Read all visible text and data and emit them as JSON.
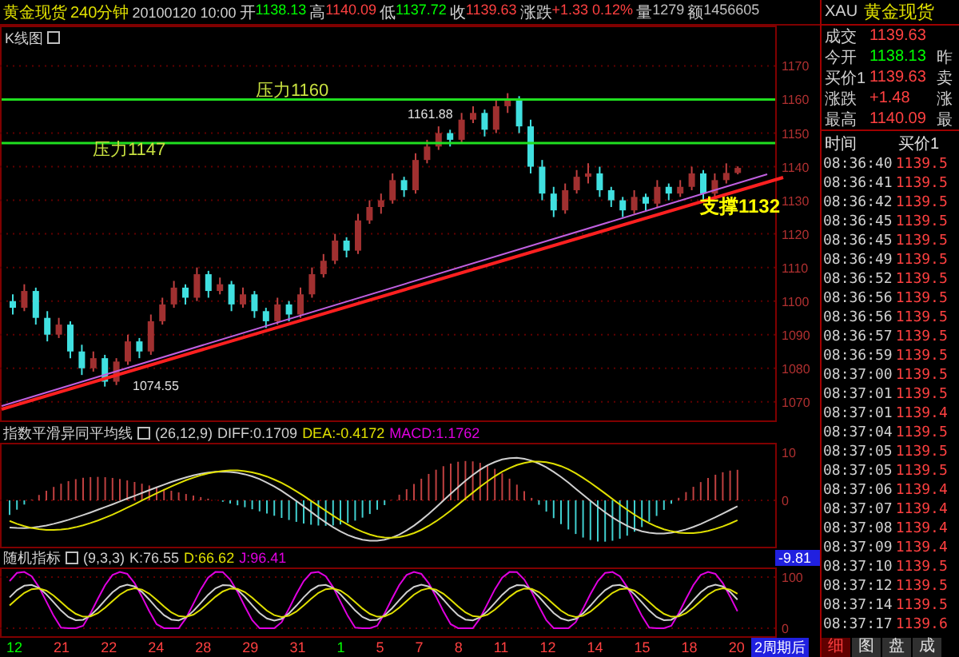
{
  "header": {
    "symbol": "黄金现货",
    "period": "240分钟",
    "datetime": "20100120 10:00",
    "fields": [
      {
        "label": "开",
        "value": "1138.13",
        "color": "#00ff00"
      },
      {
        "label": "高",
        "value": "1140.09",
        "color": "#ff4040"
      },
      {
        "label": "低",
        "value": "1137.72",
        "color": "#00ff00"
      },
      {
        "label": "收",
        "value": "1139.63",
        "color": "#ff4040"
      },
      {
        "label": "涨跌",
        "value": "+1.33 0.12%",
        "color": "#ff4040"
      },
      {
        "label": "量",
        "value": "1279",
        "color": "#c0c0c0"
      },
      {
        "label": "额",
        "value": "1456605",
        "color": "#c0c0c0"
      }
    ]
  },
  "main_chart": {
    "title": "K线图",
    "chart_data": {
      "type": "candlestick",
      "ylim": [
        1064,
        1182
      ],
      "yticks": [
        1170,
        1160,
        1150,
        1140,
        1130,
        1120,
        1110,
        1100,
        1090,
        1080,
        1070
      ],
      "grid": true,
      "ref_lines": [
        {
          "axis": "y",
          "value": 1160,
          "color": "#20e020"
        },
        {
          "axis": "y",
          "value": 1147,
          "color": "#20e020"
        }
      ],
      "ohlc": [
        [
          1100,
          1102,
          1096,
          1098
        ],
        [
          1098,
          1105,
          1097,
          1103
        ],
        [
          1103,
          1104,
          1093,
          1095
        ],
        [
          1095,
          1097,
          1088,
          1090
        ],
        [
          1090,
          1095,
          1089,
          1093
        ],
        [
          1093,
          1094,
          1083,
          1085
        ],
        [
          1085,
          1087,
          1078,
          1080
        ],
        [
          1080,
          1085,
          1079,
          1083
        ],
        [
          1083,
          1084,
          1074.55,
          1076
        ],
        [
          1076,
          1083,
          1075,
          1082
        ],
        [
          1082,
          1090,
          1081,
          1088
        ],
        [
          1088,
          1089,
          1083,
          1085
        ],
        [
          1085,
          1096,
          1084,
          1094
        ],
        [
          1094,
          1101,
          1093,
          1099
        ],
        [
          1099,
          1106,
          1098,
          1104
        ],
        [
          1104,
          1105,
          1099,
          1101
        ],
        [
          1101,
          1110,
          1100,
          1108
        ],
        [
          1108,
          1109,
          1101,
          1103
        ],
        [
          1103,
          1107,
          1102,
          1105
        ],
        [
          1105,
          1106,
          1097,
          1099
        ],
        [
          1099,
          1104,
          1098,
          1102
        ],
        [
          1102,
          1103,
          1095,
          1097
        ],
        [
          1097,
          1098,
          1092,
          1094
        ],
        [
          1094,
          1101,
          1093,
          1099
        ],
        [
          1099,
          1100,
          1094,
          1096
        ],
        [
          1096,
          1104,
          1095,
          1102
        ],
        [
          1102,
          1110,
          1101,
          1108
        ],
        [
          1108,
          1114,
          1107,
          1112
        ],
        [
          1112,
          1120,
          1111,
          1118
        ],
        [
          1118,
          1119,
          1113,
          1115
        ],
        [
          1115,
          1126,
          1114,
          1124
        ],
        [
          1124,
          1130,
          1123,
          1128
        ],
        [
          1128,
          1132,
          1126,
          1130
        ],
        [
          1130,
          1138,
          1129,
          1136
        ],
        [
          1136,
          1137,
          1131,
          1133
        ],
        [
          1133,
          1144,
          1132,
          1142
        ],
        [
          1142,
          1148,
          1141,
          1146
        ],
        [
          1146,
          1152,
          1145,
          1150
        ],
        [
          1150,
          1151,
          1146,
          1148
        ],
        [
          1148,
          1156,
          1147,
          1154
        ],
        [
          1154,
          1158,
          1153,
          1156
        ],
        [
          1156,
          1157,
          1149,
          1151
        ],
        [
          1151,
          1160,
          1150,
          1158
        ],
        [
          1158,
          1161.88,
          1156,
          1160
        ],
        [
          1160,
          1161,
          1150,
          1152
        ],
        [
          1152,
          1154,
          1138,
          1140
        ],
        [
          1140,
          1142,
          1130,
          1132
        ],
        [
          1132,
          1134,
          1125,
          1127
        ],
        [
          1127,
          1135,
          1126,
          1133
        ],
        [
          1133,
          1139,
          1132,
          1137
        ],
        [
          1137,
          1141,
          1135,
          1138
        ],
        [
          1138,
          1140,
          1131,
          1133
        ],
        [
          1133,
          1134,
          1128,
          1130
        ],
        [
          1130,
          1131,
          1125,
          1127
        ],
        [
          1127,
          1133,
          1126,
          1131
        ],
        [
          1131,
          1132,
          1127,
          1129
        ],
        [
          1129,
          1136,
          1128,
          1134
        ],
        [
          1134,
          1135,
          1130,
          1132
        ],
        [
          1132,
          1136,
          1131,
          1134
        ],
        [
          1134,
          1140,
          1133,
          1138
        ],
        [
          1138,
          1139,
          1130,
          1132
        ],
        [
          1132,
          1138,
          1131,
          1136
        ],
        [
          1136,
          1141,
          1135,
          1138.13
        ],
        [
          1138.13,
          1140.09,
          1137.72,
          1139.63
        ]
      ]
    },
    "annotations": [
      {
        "kind": "resistance",
        "text": "压力1160"
      },
      {
        "kind": "resistance",
        "text": "压力1147"
      },
      {
        "kind": "support",
        "text": "支撑1132"
      },
      {
        "kind": "price",
        "text": "1161.88"
      },
      {
        "kind": "price",
        "text": "1074.55"
      }
    ]
  },
  "macd": {
    "title": "指数平滑异同平均线",
    "params": "(26,12,9)",
    "values": [
      {
        "text": "DIFF:0.1709",
        "color": "#d0d0d0"
      },
      {
        "text": "DEA:-0.4172",
        "color": "#e0e000"
      },
      {
        "text": "MACD:1.1762",
        "color": "#e000e0"
      }
    ],
    "yticks": [
      "10",
      "0"
    ],
    "current_value": "-9.81"
  },
  "kdj": {
    "title": "随机指标",
    "params": "(9,3,3)",
    "values": [
      {
        "text": "K:76.55",
        "color": "#d0d0d0"
      },
      {
        "text": "D:66.62",
        "color": "#e0e000"
      },
      {
        "text": "J:96.41",
        "color": "#e000e0"
      }
    ],
    "yticks": [
      "100",
      "0"
    ]
  },
  "x_axis": {
    "labels": [
      {
        "text": "12",
        "color": "#00ff00"
      },
      {
        "text": "21",
        "color": "#ff4040"
      },
      {
        "text": "22",
        "color": "#ff4040"
      },
      {
        "text": "24",
        "color": "#ff4040"
      },
      {
        "text": "28",
        "color": "#ff4040"
      },
      {
        "text": "29",
        "color": "#ff4040"
      },
      {
        "text": "31",
        "color": "#ff4040"
      },
      {
        "text": "1",
        "color": "#00ff00"
      },
      {
        "text": "5",
        "color": "#ff4040"
      },
      {
        "text": "7",
        "color": "#ff4040"
      },
      {
        "text": "8",
        "color": "#ff4040"
      },
      {
        "text": "11",
        "color": "#ff4040"
      },
      {
        "text": "12",
        "color": "#ff4040"
      },
      {
        "text": "14",
        "color": "#ff4040"
      },
      {
        "text": "15",
        "color": "#ff4040"
      },
      {
        "text": "18",
        "color": "#ff4040"
      },
      {
        "text": "20",
        "color": "#ff4040"
      }
    ],
    "future": "2周期后"
  },
  "quote_panel": {
    "symbol": "XAU",
    "name": "黄金现货",
    "rows": [
      {
        "label": "成交",
        "value": "1139.63",
        "color": "#ff4040"
      },
      {
        "label": "今开",
        "value": "1138.13",
        "color": "#00ff00",
        "label_2": "昨"
      },
      {
        "label": "买价1",
        "value": "1139.63",
        "color": "#ff4040",
        "label_2": "卖"
      },
      {
        "label": "涨跌",
        "value": "+1.48",
        "color": "#ff4040",
        "label_2": "涨"
      },
      {
        "label": "最高",
        "value": "1140.09",
        "color": "#ff4040",
        "label_2": "最"
      }
    ]
  },
  "ticks": {
    "columns": [
      "时间",
      "买价1"
    ],
    "rows": [
      {
        "time": "08:36:40",
        "price": "1139.5"
      },
      {
        "time": "08:36:41",
        "price": "1139.5"
      },
      {
        "time": "08:36:42",
        "price": "1139.5"
      },
      {
        "time": "08:36:45",
        "price": "1139.5"
      },
      {
        "time": "08:36:45",
        "price": "1139.5"
      },
      {
        "time": "08:36:49",
        "price": "1139.5"
      },
      {
        "time": "08:36:52",
        "price": "1139.5"
      },
      {
        "time": "08:36:56",
        "price": "1139.5"
      },
      {
        "time": "08:36:56",
        "price": "1139.5"
      },
      {
        "time": "08:36:57",
        "price": "1139.5"
      },
      {
        "time": "08:36:59",
        "price": "1139.5"
      },
      {
        "time": "08:37:00",
        "price": "1139.5"
      },
      {
        "time": "08:37:01",
        "price": "1139.5"
      },
      {
        "time": "08:37:01",
        "price": "1139.4"
      },
      {
        "time": "08:37:04",
        "price": "1139.5"
      },
      {
        "time": "08:37:05",
        "price": "1139.5"
      },
      {
        "time": "08:37:05",
        "price": "1139.5"
      },
      {
        "time": "08:37:06",
        "price": "1139.4"
      },
      {
        "time": "08:37:07",
        "price": "1139.4"
      },
      {
        "time": "08:37:08",
        "price": "1139.4"
      },
      {
        "time": "08:37:09",
        "price": "1139.4"
      },
      {
        "time": "08:37:10",
        "price": "1139.5"
      },
      {
        "time": "08:37:12",
        "price": "1139.5"
      },
      {
        "time": "08:37:14",
        "price": "1139.5"
      },
      {
        "time": "08:37:17",
        "price": "1139.6"
      }
    ]
  },
  "tabs": [
    {
      "label": "细",
      "selected": true
    },
    {
      "label": "图",
      "selected": false
    },
    {
      "label": "盘",
      "selected": false
    },
    {
      "label": "成",
      "selected": false
    }
  ]
}
